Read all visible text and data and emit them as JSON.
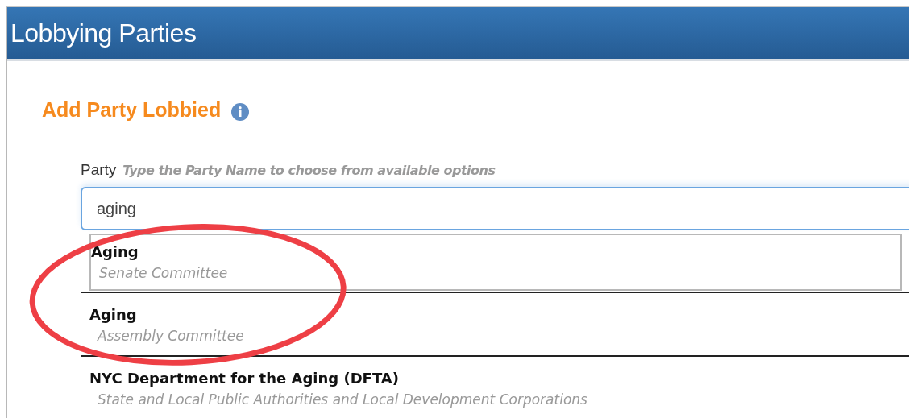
{
  "header": {
    "title": "Lobbying Parties"
  },
  "section": {
    "title": "Add Party Lobbied",
    "info": true
  },
  "party_field": {
    "label": "Party",
    "hint": "Type the Party Name to choose from available options",
    "value": "aging"
  },
  "suggestions": [
    {
      "name": "Aging",
      "category": "Senate Committee",
      "selected": true
    },
    {
      "name": "Aging",
      "category": "Assembly Committee",
      "selected": false
    },
    {
      "name": "NYC Department for the Aging (DFTA)",
      "category": "State and Local Public Authorities and Local Development Corporations",
      "selected": false
    }
  ],
  "annotation": {
    "kind": "ellipse"
  }
}
